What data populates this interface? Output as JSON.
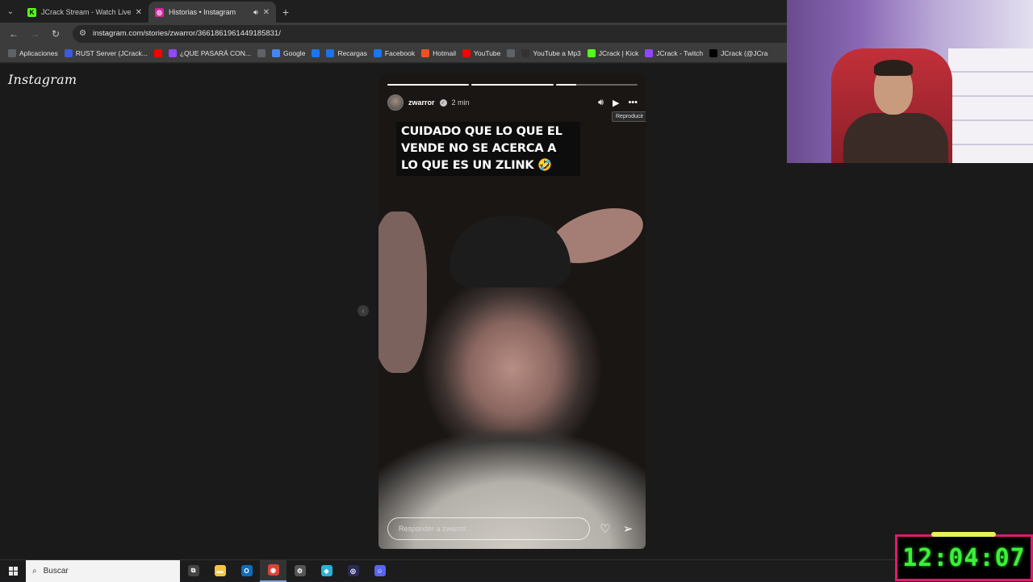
{
  "browser": {
    "tabs": [
      {
        "title": "JCrack Stream - Watch Live on Kick",
        "favicon_color": "#53fc18",
        "favicon_letter": "K",
        "active": false
      },
      {
        "title": "Historias • Instagram",
        "favicon_color": "#d6249f",
        "favicon_letter": "◎",
        "active": true
      }
    ],
    "url": "instagram.com/stories/zwarror/3661861961449185831/",
    "bookmarks": [
      {
        "label": "Aplicaciones",
        "icon": "apps-grid-icon",
        "color": "#5f6368"
      },
      {
        "label": "RUST Server (JCrack...",
        "icon": "rust-icon",
        "color": "#3b5bdb"
      },
      {
        "label": "",
        "icon": "youtube-icon",
        "color": "#ff0000"
      },
      {
        "label": "¿QUE PASARÁ CON...",
        "icon": "twitch-icon",
        "color": "#9146ff"
      },
      {
        "label": "",
        "icon": "globe-icon",
        "color": "#5f6368"
      },
      {
        "label": "Google",
        "icon": "google-icon",
        "color": "#4285f4"
      },
      {
        "label": "",
        "icon": "facebook-icon",
        "color": "#1877f2"
      },
      {
        "label": "Recargas",
        "icon": "recargas-icon",
        "color": "#1a73e8"
      },
      {
        "label": "Facebook",
        "icon": "facebook-icon",
        "color": "#1877f2"
      },
      {
        "label": "Hotmail",
        "icon": "hotmail-icon",
        "color": "#f25022"
      },
      {
        "label": "YouTube",
        "icon": "youtube-icon",
        "color": "#ff0000"
      },
      {
        "label": "",
        "icon": "globe-icon",
        "color": "#5f6368"
      },
      {
        "label": "YouTube a Mp3",
        "icon": "mp3-icon",
        "color": "#333333"
      },
      {
        "label": "JCrack | Kick",
        "icon": "kick-icon",
        "color": "#53fc18"
      },
      {
        "label": "JCrack - Twitch",
        "icon": "twitch-icon",
        "color": "#9146ff"
      },
      {
        "label": "JCrack (@JCra",
        "icon": "x-icon",
        "color": "#000000"
      }
    ]
  },
  "instagram": {
    "logo": "Instagram",
    "story": {
      "username": "zwarror",
      "time": "2 min",
      "progress": [
        1.0,
        1.0,
        0.25
      ],
      "caption": "CUIDADO QUE LO QUE EL VENDE NO SE ACERCA A LO QUE ES UN ZLINK 🤣",
      "tooltip": "Reproducir",
      "reply_placeholder": "Responder a zwarror..."
    }
  },
  "overlay": {
    "clock": "12:04:07"
  },
  "taskbar": {
    "search_label": "Buscar",
    "apps": [
      {
        "icon": "task-view-icon",
        "color": "#444444"
      },
      {
        "icon": "file-explorer-icon",
        "color": "#f5c542"
      },
      {
        "icon": "outlook-icon",
        "color": "#0f6cbd"
      },
      {
        "icon": "chrome-icon",
        "color": "#db4437"
      },
      {
        "icon": "steam-icon",
        "color": "#555555"
      },
      {
        "icon": "app-icon",
        "color": "#2ab0d9"
      },
      {
        "icon": "obs-icon",
        "color": "#2b2b5a"
      },
      {
        "icon": "discord-icon",
        "color": "#5865f2"
      }
    ]
  }
}
